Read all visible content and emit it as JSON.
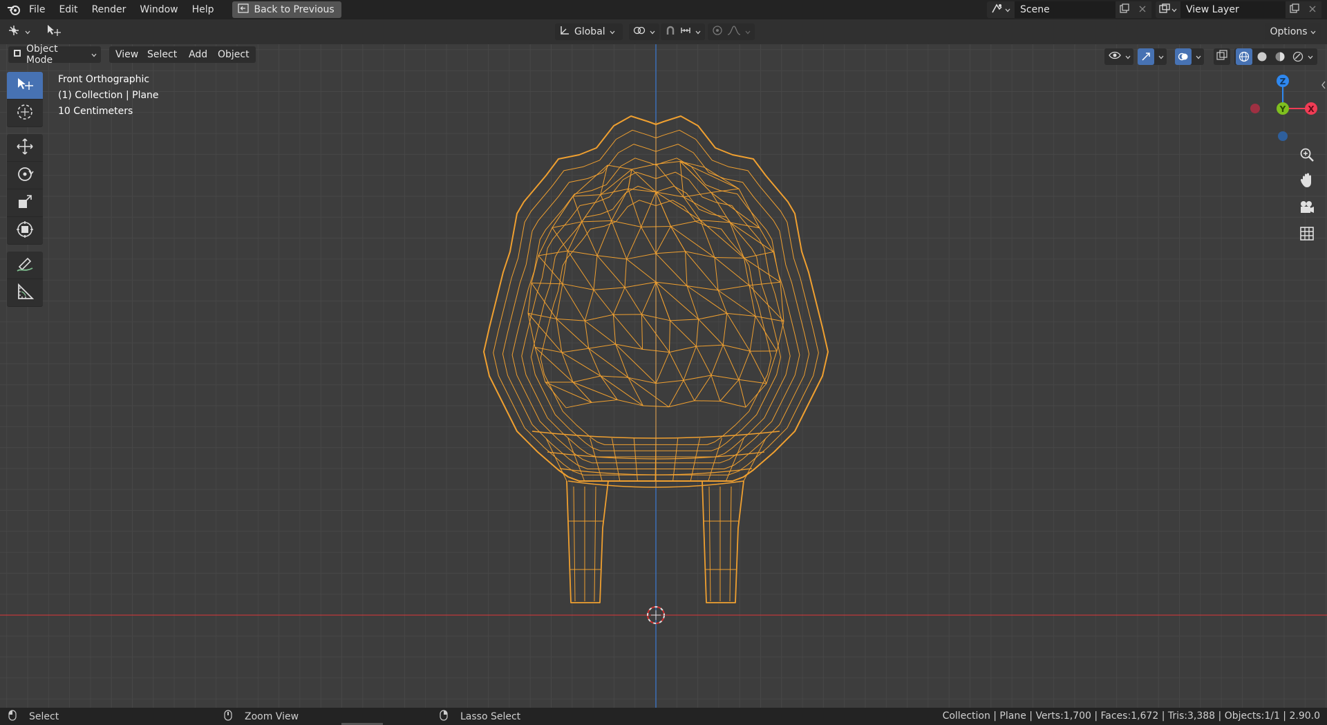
{
  "menubar": {
    "items": [
      "File",
      "Edit",
      "Render",
      "Window",
      "Help"
    ],
    "back_button": "Back to Previous",
    "scene_name": "Scene",
    "view_layer_name": "View Layer"
  },
  "toolbar": {
    "orientation": "Global",
    "options": "Options"
  },
  "viewport_header": {
    "mode": "Object Mode",
    "menus": [
      "View",
      "Select",
      "Add",
      "Object"
    ]
  },
  "overlay": {
    "view_name": "Front Orthographic",
    "collection": "(1) Collection | Plane",
    "scale": "10 Centimeters"
  },
  "gizmo": {
    "z_label": "Z",
    "y_label": "Y",
    "x_label": "X"
  },
  "statusbar": {
    "left_mouse": "Select",
    "middle_mouse": "Zoom View",
    "right_mouse": "Lasso Select",
    "stats": "Collection | Plane | Verts:1,700 | Faces:1,672 | Tris:3,388 | Objects:1/1 | 2.90.0"
  },
  "colors": {
    "wireframe": "#f0a030",
    "active_tool": "#4772b3",
    "x_axis": "#c0393b",
    "z_axis": "#3b7bd6",
    "y_gizmo": "#7fbf1f",
    "z_gizmo": "#2e88f0",
    "x_gizmo": "#f03c55"
  }
}
